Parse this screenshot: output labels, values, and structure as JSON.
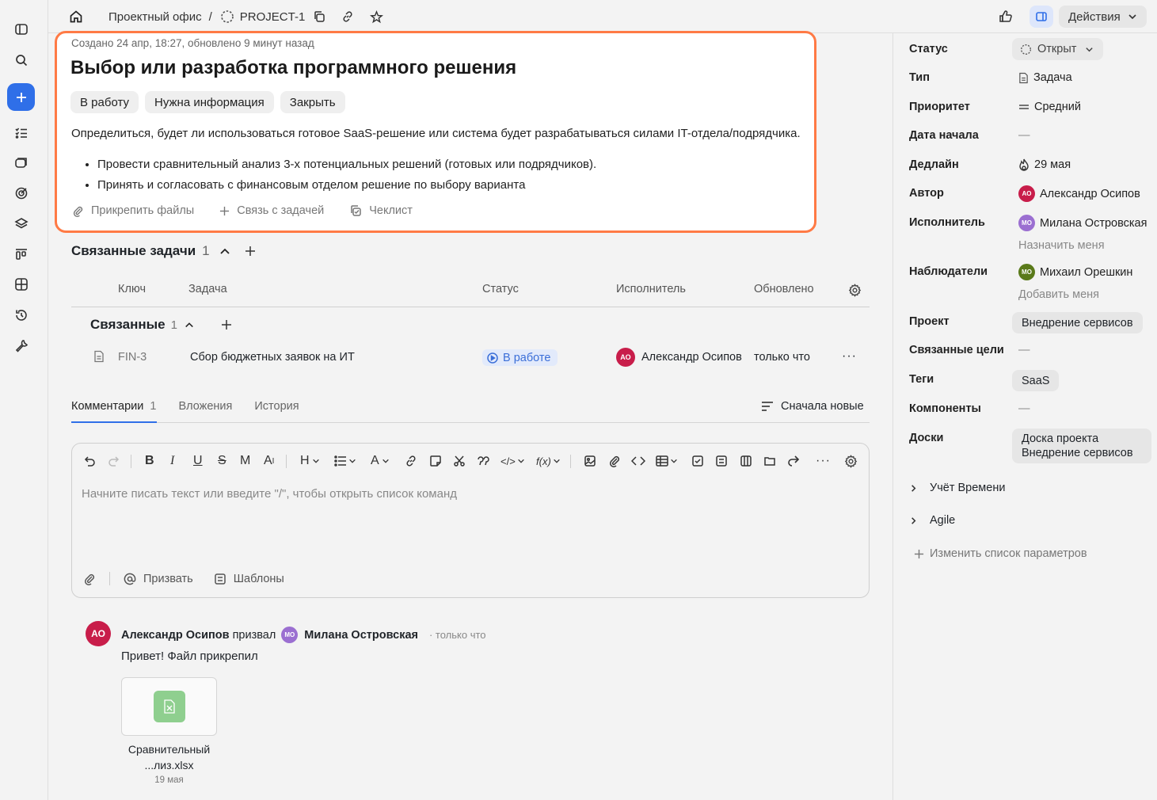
{
  "breadcrumb": {
    "office": "Проектный офис",
    "separator": "/",
    "project": "PROJECT-1"
  },
  "topbar": {
    "actions_label": "Действия"
  },
  "issue": {
    "meta": "Создано 24 апр, 18:27, обновлено 9 минут назад",
    "title": "Выбор или разработка программного решения",
    "transitions": [
      "В работу",
      "Нужна информация",
      "Закрыть"
    ],
    "description": "Определиться, будет ли использоваться готовое SaaS-решение или система будет разрабатываться силами IT-отдела/подрядчика.",
    "bullets": [
      "Провести сравнительный анализ 3-х потенциальных решений (готовых или подрядчиков).",
      "Принять и согласовать с финансовым отделом решение по выбору варианта"
    ],
    "actions": {
      "attach": "Прикрепить файлы",
      "link": "Связь с задачей",
      "checklist": "Чеклист"
    }
  },
  "related": {
    "title": "Связанные задачи",
    "count": "1",
    "columns": {
      "key": "Ключ",
      "task": "Задача",
      "status": "Статус",
      "assignee": "Исполнитель",
      "updated": "Обновлено"
    },
    "group_title": "Связанные",
    "group_count": "1",
    "rows": [
      {
        "key": "FIN-3",
        "task": "Сбор бюджетных заявок на ИТ",
        "status": "В работе",
        "assignee_initials": "АО",
        "assignee": "Александр Осипов",
        "updated": "только что"
      }
    ]
  },
  "tabs": {
    "comments": "Комментарии",
    "comments_count": "1",
    "attachments": "Вложения",
    "history": "История",
    "sort": "Сначала новые"
  },
  "editor": {
    "placeholder": "Начните писать текст или введите \"/\", чтобы открыть список команд",
    "mention": "Призвать",
    "templates": "Шаблоны",
    "toolbar": {
      "heading": "H",
      "text_color": "A",
      "formula": "f(x)",
      "strike": "S",
      "mono": "M"
    }
  },
  "comment": {
    "author_initials": "АО",
    "author": "Александр Осипов",
    "verb": "призвал",
    "mentioned_initials": "МО",
    "mentioned": "Милана Островская",
    "time": "· только что",
    "text": "Привет! Файл прикрепил",
    "file_name_line1": "Сравнительный",
    "file_name_line2": "...лиз.xlsx",
    "file_date": "19 мая"
  },
  "props": {
    "status": {
      "label": "Статус",
      "value": "Открыт"
    },
    "type": {
      "label": "Тип",
      "value": "Задача"
    },
    "priority": {
      "label": "Приоритет",
      "value": "Средний"
    },
    "start": {
      "label": "Дата начала",
      "value": "—"
    },
    "deadline": {
      "label": "Дедлайн",
      "value": "29 мая"
    },
    "author": {
      "label": "Автор",
      "initials": "АО",
      "value": "Александр Осипов"
    },
    "assignee": {
      "label": "Исполнитель",
      "initials": "МО",
      "value": "Милана Островская",
      "assign_me": "Назначить меня"
    },
    "watchers": {
      "label": "Наблюдатели",
      "initials": "МО",
      "value": "Михаил Орешкин",
      "add_me": "Добавить меня"
    },
    "project": {
      "label": "Проект",
      "value": "Внедрение сервисов"
    },
    "goals": {
      "label": "Связанные цели",
      "value": "—"
    },
    "tags": {
      "label": "Теги",
      "value": "SaaS"
    },
    "components": {
      "label": "Компоненты",
      "value": "—"
    },
    "boards": {
      "label": "Доски",
      "value_line1": "Доска проекта",
      "value_line2": "Внедрение сервисов"
    },
    "time_tracking": "Учёт Времени",
    "agile": "Agile",
    "edit_params": "Изменить список параметров"
  },
  "colors": {
    "accent": "#ff7a45",
    "primary": "#2f6fe8",
    "avatar_red": "#c81d4a",
    "avatar_purple": "#9b6fd1",
    "avatar_green": "#5a7a1a",
    "status_blue": "#3b6fd8"
  }
}
